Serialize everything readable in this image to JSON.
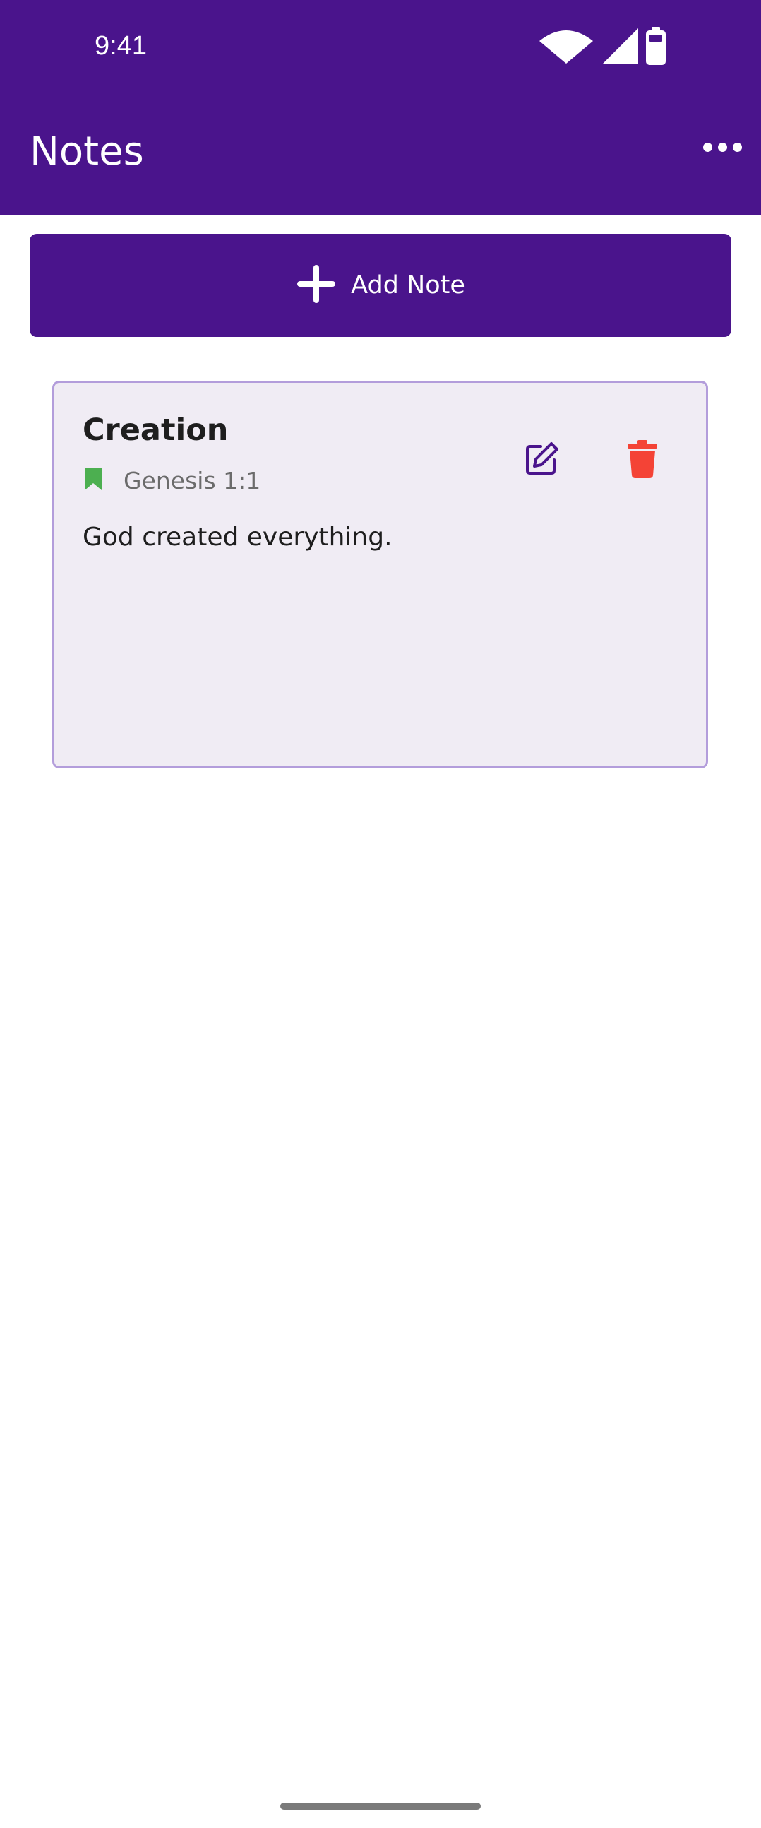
{
  "status_bar": {
    "time": "9:41",
    "icons": [
      "wifi-icon",
      "cellular-signal-icon",
      "battery-icon"
    ]
  },
  "app_bar": {
    "title": "Notes",
    "menu_icon": "more-horizontal-icon"
  },
  "add_button": {
    "icon": "plus-icon",
    "label": "Add Note"
  },
  "notes": [
    {
      "title": "Creation",
      "reference_icon": "bookmark-icon",
      "reference": "Genesis 1:1",
      "body": "God created everything.",
      "edit_icon": "edit-icon",
      "delete_icon": "trash-icon"
    }
  ],
  "colors": {
    "primary": "#4a148c",
    "card_background": "#f0ecf4",
    "card_border": "#b39ddb",
    "bookmark": "#4caf50",
    "delete": "#f44336",
    "edit": "#4a148c"
  }
}
